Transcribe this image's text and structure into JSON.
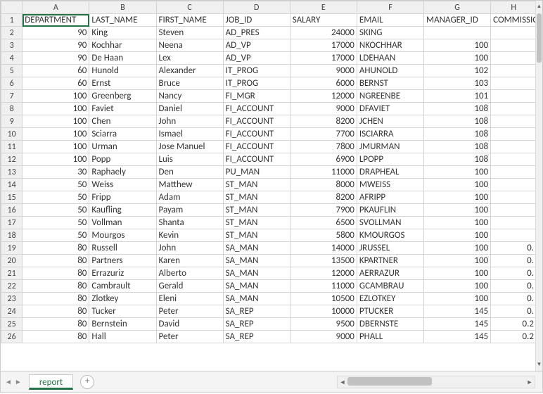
{
  "columns": [
    "A",
    "B",
    "C",
    "D",
    "E",
    "F",
    "G",
    "H"
  ],
  "headers": [
    "DEPARTMENT_ID",
    "LAST_NAME",
    "FIRST_NAME",
    "JOB_ID",
    "SALARY",
    "EMAIL",
    "MANAGER_ID",
    "COMMISSION"
  ],
  "header_display": {
    "A": "DEPARTMENT",
    "H": "COMMISSION"
  },
  "rows": [
    {
      "r": 2,
      "A": 90,
      "B": "King",
      "C": "Steven",
      "D": "AD_PRES",
      "E": 24000,
      "F": "SKING",
      "G": "",
      "H": ""
    },
    {
      "r": 3,
      "A": 90,
      "B": "Kochhar",
      "C": "Neena",
      "D": "AD_VP",
      "E": 17000,
      "F": "NKOCHHAR",
      "G": 100,
      "H": ""
    },
    {
      "r": 4,
      "A": 90,
      "B": "De Haan",
      "C": "Lex",
      "D": "AD_VP",
      "E": 17000,
      "F": "LDEHAAN",
      "G": 100,
      "H": ""
    },
    {
      "r": 5,
      "A": 60,
      "B": "Hunold",
      "C": "Alexander",
      "D": "IT_PROG",
      "E": 9000,
      "F": "AHUNOLD",
      "G": 102,
      "H": ""
    },
    {
      "r": 6,
      "A": 60,
      "B": "Ernst",
      "C": "Bruce",
      "D": "IT_PROG",
      "E": 6000,
      "F": "BERNST",
      "G": 103,
      "H": ""
    },
    {
      "r": 7,
      "A": 100,
      "B": "Greenberg",
      "C": "Nancy",
      "D": "FI_MGR",
      "E": 12000,
      "F": "NGREENBE",
      "G": 101,
      "H": ""
    },
    {
      "r": 8,
      "A": 100,
      "B": "Faviet",
      "C": "Daniel",
      "D": "FI_ACCOUNT",
      "E": 9000,
      "F": "DFAVIET",
      "G": 108,
      "H": ""
    },
    {
      "r": 9,
      "A": 100,
      "B": "Chen",
      "C": "John",
      "D": "FI_ACCOUNT",
      "E": 8200,
      "F": "JCHEN",
      "G": 108,
      "H": ""
    },
    {
      "r": 10,
      "A": 100,
      "B": "Sciarra",
      "C": "Ismael",
      "D": "FI_ACCOUNT",
      "E": 7700,
      "F": "ISCIARRA",
      "G": 108,
      "H": ""
    },
    {
      "r": 11,
      "A": 100,
      "B": "Urman",
      "C": "Jose Manuel",
      "D": "FI_ACCOUNT",
      "E": 7800,
      "F": "JMURMAN",
      "G": 108,
      "H": ""
    },
    {
      "r": 12,
      "A": 100,
      "B": "Popp",
      "C": "Luis",
      "D": "FI_ACCOUNT",
      "E": 6900,
      "F": "LPOPP",
      "G": 108,
      "H": ""
    },
    {
      "r": 13,
      "A": 30,
      "B": "Raphaely",
      "C": "Den",
      "D": "PU_MAN",
      "E": 11000,
      "F": "DRAPHEAL",
      "G": 100,
      "H": ""
    },
    {
      "r": 14,
      "A": 50,
      "B": "Weiss",
      "C": "Matthew",
      "D": "ST_MAN",
      "E": 8000,
      "F": "MWEISS",
      "G": 100,
      "H": ""
    },
    {
      "r": 15,
      "A": 50,
      "B": "Fripp",
      "C": "Adam",
      "D": "ST_MAN",
      "E": 8200,
      "F": "AFRIPP",
      "G": 100,
      "H": ""
    },
    {
      "r": 16,
      "A": 50,
      "B": "Kaufling",
      "C": "Payam",
      "D": "ST_MAN",
      "E": 7900,
      "F": "PKAUFLIN",
      "G": 100,
      "H": ""
    },
    {
      "r": 17,
      "A": 50,
      "B": "Vollman",
      "C": "Shanta",
      "D": "ST_MAN",
      "E": 6500,
      "F": "SVOLLMAN",
      "G": 100,
      "H": ""
    },
    {
      "r": 18,
      "A": 50,
      "B": "Mourgos",
      "C": "Kevin",
      "D": "ST_MAN",
      "E": 5800,
      "F": "KMOURGOS",
      "G": 100,
      "H": ""
    },
    {
      "r": 19,
      "A": 80,
      "B": "Russell",
      "C": "John",
      "D": "SA_MAN",
      "E": 14000,
      "F": "JRUSSEL",
      "G": 100,
      "H": "0."
    },
    {
      "r": 20,
      "A": 80,
      "B": "Partners",
      "C": "Karen",
      "D": "SA_MAN",
      "E": 13500,
      "F": "KPARTNER",
      "G": 100,
      "H": "0."
    },
    {
      "r": 21,
      "A": 80,
      "B": "Errazuriz",
      "C": "Alberto",
      "D": "SA_MAN",
      "E": 12000,
      "F": "AERRAZUR",
      "G": 100,
      "H": "0."
    },
    {
      "r": 22,
      "A": 80,
      "B": "Cambrault",
      "C": "Gerald",
      "D": "SA_MAN",
      "E": 11000,
      "F": "GCAMBRAU",
      "G": 100,
      "H": "0."
    },
    {
      "r": 23,
      "A": 80,
      "B": "Zlotkey",
      "C": "Eleni",
      "D": "SA_MAN",
      "E": 10500,
      "F": "EZLOTKEY",
      "G": 100,
      "H": "0."
    },
    {
      "r": 24,
      "A": 80,
      "B": "Tucker",
      "C": "Peter",
      "D": "SA_REP",
      "E": 10000,
      "F": "PTUCKER",
      "G": 145,
      "H": "0."
    },
    {
      "r": 25,
      "A": 80,
      "B": "Bernstein",
      "C": "David",
      "D": "SA_REP",
      "E": 9500,
      "F": "DBERNSTE",
      "G": 145,
      "H": "0.2"
    },
    {
      "r": 26,
      "A": 80,
      "B": "Hall",
      "C": "Peter",
      "D": "SA_REP",
      "E": 9000,
      "F": "PHALL",
      "G": 145,
      "H": "0.2"
    }
  ],
  "sheet_tab": "report",
  "selected_cell": "A1",
  "chart_data": {
    "type": "table",
    "columns": [
      "DEPARTMENT_ID",
      "LAST_NAME",
      "FIRST_NAME",
      "JOB_ID",
      "SALARY",
      "EMAIL",
      "MANAGER_ID",
      "COMMISSION"
    ],
    "rows": [
      [
        90,
        "King",
        "Steven",
        "AD_PRES",
        24000,
        "SKING",
        null,
        null
      ],
      [
        90,
        "Kochhar",
        "Neena",
        "AD_VP",
        17000,
        "NKOCHHAR",
        100,
        null
      ],
      [
        90,
        "De Haan",
        "Lex",
        "AD_VP",
        17000,
        "LDEHAAN",
        100,
        null
      ],
      [
        60,
        "Hunold",
        "Alexander",
        "IT_PROG",
        9000,
        "AHUNOLD",
        102,
        null
      ],
      [
        60,
        "Ernst",
        "Bruce",
        "IT_PROG",
        6000,
        "BERNST",
        103,
        null
      ],
      [
        100,
        "Greenberg",
        "Nancy",
        "FI_MGR",
        12000,
        "NGREENBE",
        101,
        null
      ],
      [
        100,
        "Faviet",
        "Daniel",
        "FI_ACCOUNT",
        9000,
        "DFAVIET",
        108,
        null
      ],
      [
        100,
        "Chen",
        "John",
        "FI_ACCOUNT",
        8200,
        "JCHEN",
        108,
        null
      ],
      [
        100,
        "Sciarra",
        "Ismael",
        "FI_ACCOUNT",
        7700,
        "ISCIARRA",
        108,
        null
      ],
      [
        100,
        "Urman",
        "Jose Manuel",
        "FI_ACCOUNT",
        7800,
        "JMURMAN",
        108,
        null
      ],
      [
        100,
        "Popp",
        "Luis",
        "FI_ACCOUNT",
        6900,
        "LPOPP",
        108,
        null
      ],
      [
        30,
        "Raphaely",
        "Den",
        "PU_MAN",
        11000,
        "DRAPHEAL",
        100,
        null
      ],
      [
        50,
        "Weiss",
        "Matthew",
        "ST_MAN",
        8000,
        "MWEISS",
        100,
        null
      ],
      [
        50,
        "Fripp",
        "Adam",
        "ST_MAN",
        8200,
        "AFRIPP",
        100,
        null
      ],
      [
        50,
        "Kaufling",
        "Payam",
        "ST_MAN",
        7900,
        "PKAUFLIN",
        100,
        null
      ],
      [
        50,
        "Vollman",
        "Shanta",
        "ST_MAN",
        6500,
        "SVOLLMAN",
        100,
        null
      ],
      [
        50,
        "Mourgos",
        "Kevin",
        "ST_MAN",
        5800,
        "KMOURGOS",
        100,
        null
      ],
      [
        80,
        "Russell",
        "John",
        "SA_MAN",
        14000,
        "JRUSSEL",
        100,
        0
      ],
      [
        80,
        "Partners",
        "Karen",
        "SA_MAN",
        13500,
        "KPARTNER",
        100,
        0
      ],
      [
        80,
        "Errazuriz",
        "Alberto",
        "SA_MAN",
        12000,
        "AERRAZUR",
        100,
        0
      ],
      [
        80,
        "Cambrault",
        "Gerald",
        "SA_MAN",
        11000,
        "GCAMBRAU",
        100,
        0
      ],
      [
        80,
        "Zlotkey",
        "Eleni",
        "SA_MAN",
        10500,
        "EZLOTKEY",
        100,
        0
      ],
      [
        80,
        "Tucker",
        "Peter",
        "SA_REP",
        10000,
        "PTUCKER",
        145,
        0
      ],
      [
        80,
        "Bernstein",
        "David",
        "SA_REP",
        9500,
        "DBERNSTE",
        145,
        0.2
      ],
      [
        80,
        "Hall",
        "Peter",
        "SA_REP",
        9000,
        "PHALL",
        145,
        0.2
      ]
    ]
  }
}
